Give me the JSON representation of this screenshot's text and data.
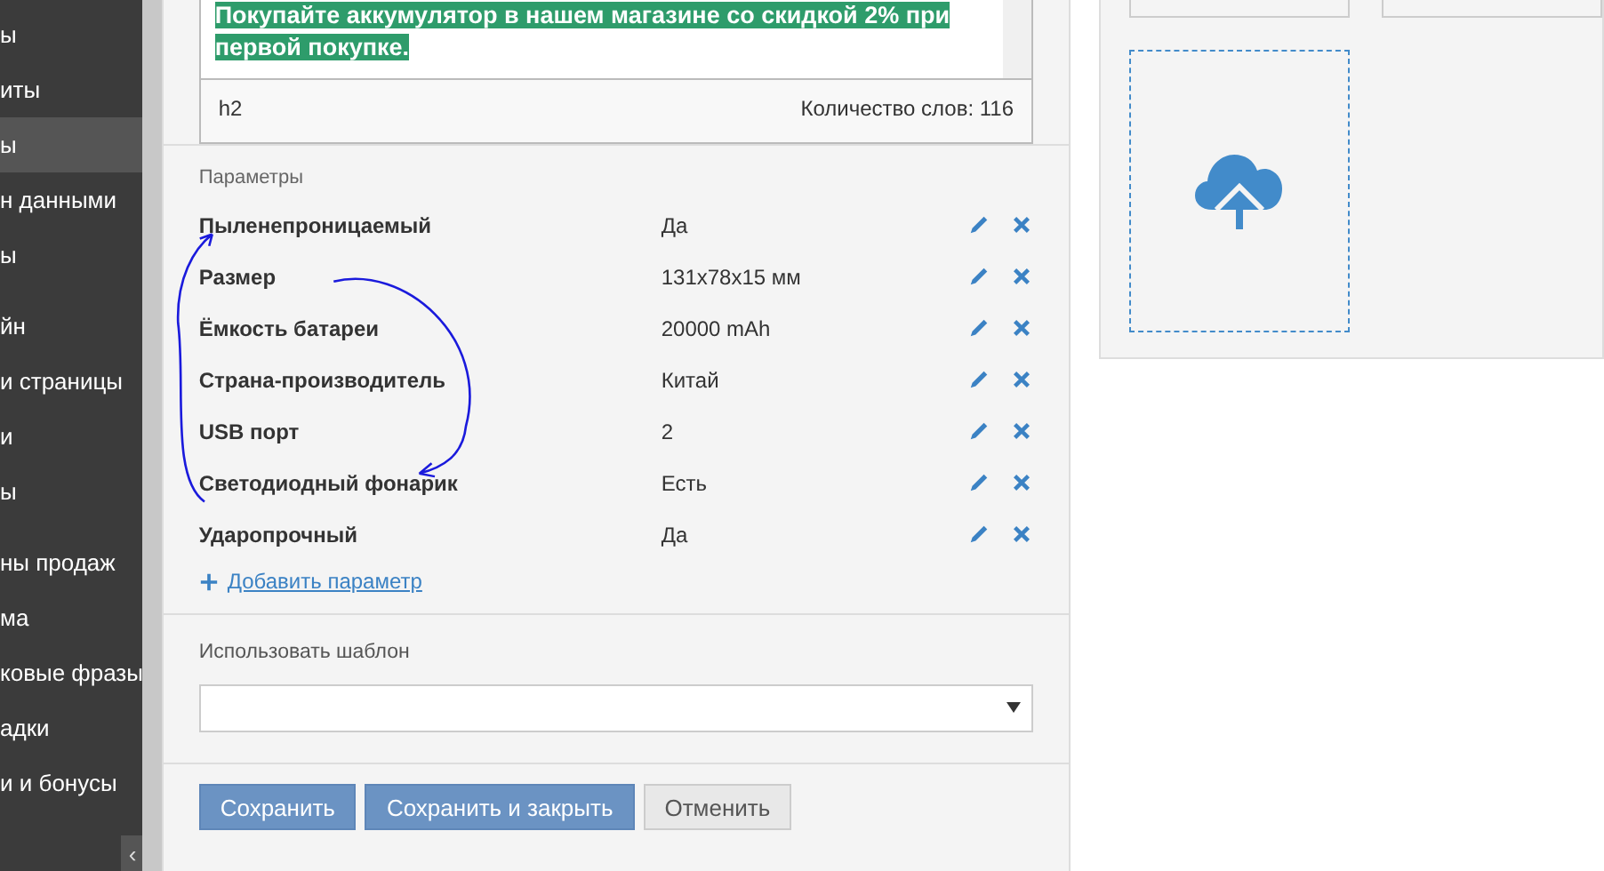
{
  "sidebar": {
    "groups": [
      {
        "items": [
          {
            "label": "ы",
            "selected": false
          },
          {
            "label": "иты",
            "selected": false
          },
          {
            "label": "ы",
            "selected": true
          },
          {
            "label": "н данными",
            "selected": false
          },
          {
            "label": "ы",
            "selected": false
          }
        ]
      },
      {
        "items": [
          {
            "label": "йн",
            "selected": false
          },
          {
            "label": "и страницы",
            "selected": false
          },
          {
            "label": "и",
            "selected": false
          },
          {
            "label": "ы",
            "selected": false
          }
        ]
      },
      {
        "items": [
          {
            "label": "ны продаж",
            "selected": false
          },
          {
            "label": "ма",
            "selected": false
          },
          {
            "label": "ковые фразы",
            "selected": false
          },
          {
            "label": "адки",
            "selected": false
          },
          {
            "label": "и и бонусы",
            "selected": false
          }
        ]
      }
    ],
    "collapse": "‹"
  },
  "editor": {
    "lines": [
      "Покупайте аккумулятор в нашем магазине со скидкой 2% при",
      "первой покупке."
    ],
    "path": "h2",
    "word_count": "Количество слов: 116"
  },
  "parameters": {
    "title": "Параметры",
    "rows": [
      {
        "name": "Пыленепроницаемый",
        "value": "Да"
      },
      {
        "name": "Размер",
        "value": "131x78x15 мм"
      },
      {
        "name": "Ёмкость батареи",
        "value": "20000 mAh"
      },
      {
        "name": "Страна-производитель",
        "value": "Китай"
      },
      {
        "name": "USB порт",
        "value": "2"
      },
      {
        "name": "Светодиодный фонарик",
        "value": "Есть"
      },
      {
        "name": "Ударопрочный",
        "value": "Да"
      }
    ],
    "add": "Добавить параметр"
  },
  "template": {
    "label": "Использовать шаблон"
  },
  "buttons": [
    {
      "label": "Сохранить",
      "kind": "primary"
    },
    {
      "label": "Сохранить и закрыть",
      "kind": "primary"
    },
    {
      "label": "Отменить",
      "kind": "secondary"
    }
  ]
}
